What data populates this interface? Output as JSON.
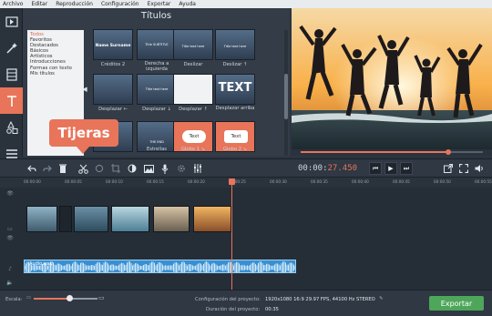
{
  "menu": [
    "Archivo",
    "Editar",
    "Reproducción",
    "Configuración",
    "Exportar",
    "Ayuda"
  ],
  "panel": {
    "title": "Títulos",
    "categories": [
      "Todos",
      "Favoritos",
      "Destacados",
      "Básicos",
      "Artísticos",
      "Introducciones",
      "Formas con texto",
      "Mis títulos"
    ],
    "row1": [
      "Créditos 2",
      "Derecha a izquierda",
      "Deslizar",
      "Deslizar ↑"
    ],
    "row2": [
      "Desplazar ←",
      "Desplazar ↓",
      "Desplazar ↑",
      "Desplazar arriba"
    ],
    "row3": [
      "",
      "Estrellas",
      "Globo 1 ↘",
      "Globo 2 ↘"
    ],
    "thumb_text": [
      "Name Surname",
      "Title SUBTITLE",
      "Title text here",
      "Title text here",
      "Title text here",
      "TEXT",
      "THE END",
      "Text",
      "Text"
    ]
  },
  "tooltip": "Tijeras",
  "player": {
    "time_dim": "00:00:",
    "time_hi": "27.450",
    "progress": 0.81
  },
  "ruler": [
    "00:00:00",
    "00:00:05",
    "00:00:10",
    "00:00:15",
    "00:00:20",
    "00:00:25",
    "00:00:30",
    "00:00:35",
    "00:00:40",
    "00:00:45",
    "00:00:50",
    "00:00:55"
  ],
  "audio": {
    "name": "Audio.wav"
  },
  "status": {
    "scale_label": "Escala:",
    "config_label": "Configuración del proyecto:",
    "config_value": "1920x1080 16:9 29.97 FPS, 44100 Hz STEREO",
    "duration_label": "Duración del proyecto:",
    "duration_value": "00:35",
    "export": "Exportar",
    "zoom": 0.55
  },
  "colors": {
    "accent": "#e8745a",
    "export": "#4ea65a"
  }
}
